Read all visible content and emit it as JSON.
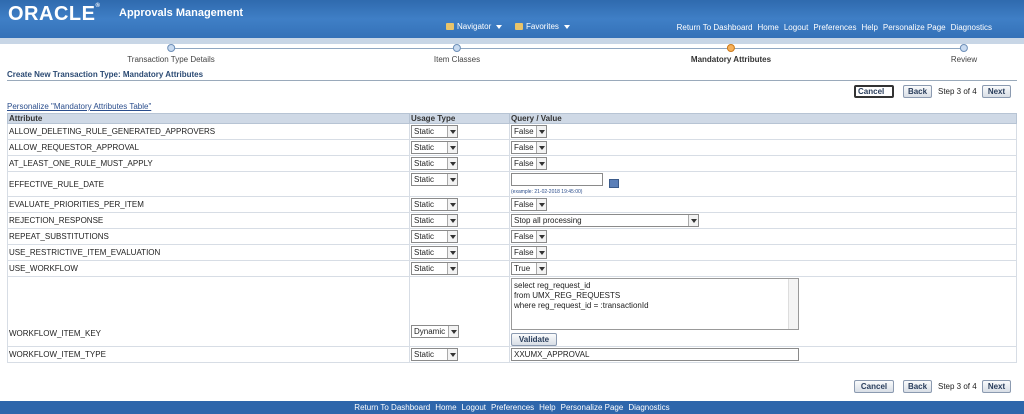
{
  "app": {
    "logo": "ORACLE",
    "logo_mark": "®",
    "title": "Approvals Management"
  },
  "nav": {
    "navigator": "Navigator",
    "favorites": "Favorites"
  },
  "global_links": [
    "Return To Dashboard",
    "Home",
    "Logout",
    "Preferences",
    "Help",
    "Personalize Page",
    "Diagnostics"
  ],
  "train": {
    "steps": [
      "Transaction Type Details",
      "Item Classes",
      "Mandatory Attributes",
      "Review"
    ],
    "active_index": 2
  },
  "page_title": "Create New Transaction Type: Mandatory Attributes",
  "buttons": {
    "cancel": "Cancel",
    "back": "Back",
    "next": "Next",
    "step": "Step 3 of 4",
    "validate": "Validate"
  },
  "personalize_link": "Personalize \"Mandatory Attributes Table\"",
  "table": {
    "headers": [
      "Attribute",
      "Usage Type",
      "Query / Value"
    ],
    "rows": [
      {
        "attr": "ALLOW_DELETING_RULE_GENERATED_APPROVERS",
        "usage": "Static",
        "value": "False",
        "vtype": "select"
      },
      {
        "attr": "ALLOW_REQUESTOR_APPROVAL",
        "usage": "Static",
        "value": "False",
        "vtype": "select"
      },
      {
        "attr": "AT_LEAST_ONE_RULE_MUST_APPLY",
        "usage": "Static",
        "value": "False",
        "vtype": "select"
      },
      {
        "attr": "EFFECTIVE_RULE_DATE",
        "usage": "Static",
        "value": "",
        "vtype": "date",
        "hint": "(example: 21-02-2018 19:45:00)"
      },
      {
        "attr": "EVALUATE_PRIORITIES_PER_ITEM",
        "usage": "Static",
        "value": "False",
        "vtype": "select"
      },
      {
        "attr": "REJECTION_RESPONSE",
        "usage": "Static",
        "value": "Stop all processing",
        "vtype": "wideselect"
      },
      {
        "attr": "REPEAT_SUBSTITUTIONS",
        "usage": "Static",
        "value": "False",
        "vtype": "select"
      },
      {
        "attr": "USE_RESTRICTIVE_ITEM_EVALUATION",
        "usage": "Static",
        "value": "False",
        "vtype": "select"
      },
      {
        "attr": "USE_WORKFLOW",
        "usage": "Static",
        "value": "True",
        "vtype": "select"
      },
      {
        "attr": "WORKFLOW_ITEM_KEY",
        "usage": "Dynamic",
        "value": "select reg_request_id\nfrom UMX_REG_REQUESTS\nwhere reg_request_id = :transactionId",
        "vtype": "query"
      },
      {
        "attr": "WORKFLOW_ITEM_TYPE",
        "usage": "Static",
        "value": "XXUMX_APPROVAL",
        "vtype": "text"
      }
    ]
  },
  "footer_links": [
    "Return To Dashboard",
    "Home",
    "Logout",
    "Preferences",
    "Help",
    "Personalize Page",
    "Diagnostics"
  ]
}
